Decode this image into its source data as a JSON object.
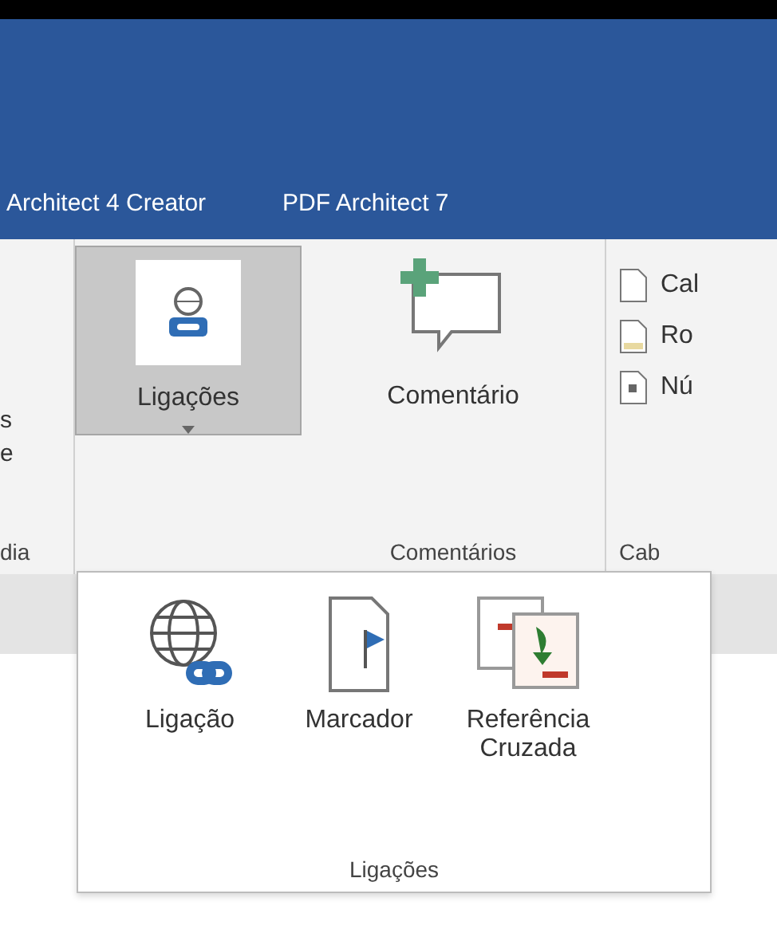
{
  "tabs": [
    {
      "label": "Architect 4 Creator"
    },
    {
      "label": "PDF Architect 7"
    }
  ],
  "ribbon": {
    "left_group": {
      "lines": [
        "s",
        "e"
      ],
      "label": "dia"
    },
    "links_button": {
      "label": "Ligações",
      "selected": true
    },
    "comment_group": {
      "button_label": "Comentário",
      "label": "Comentários"
    },
    "header_group": {
      "items": [
        {
          "label": "Cal",
          "kind": "page"
        },
        {
          "label": "Ro",
          "kind": "footer"
        },
        {
          "label": "Nú",
          "kind": "number"
        }
      ],
      "label": "Cab"
    }
  },
  "dropdown": {
    "buttons": [
      {
        "label": "Ligação",
        "kind": "link"
      },
      {
        "label": "Marcador",
        "kind": "bookmark"
      },
      {
        "label": "Referência Cruzada",
        "kind": "crossref"
      }
    ],
    "group_label": "Ligações"
  }
}
